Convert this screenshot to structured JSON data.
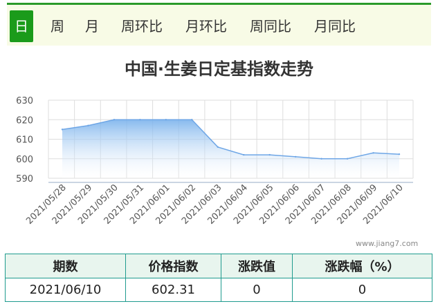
{
  "tabs": [
    "日",
    "周",
    "月",
    "周环比",
    "月环比",
    "周同比",
    "月同比"
  ],
  "chart_data": {
    "type": "area",
    "title": "中国·生姜日定基指数走势",
    "x": [
      "2021/05/28",
      "2021/05/29",
      "2021/05/30",
      "2021/05/31",
      "2021/06/01",
      "2021/06/02",
      "2021/06/03",
      "2021/06/04",
      "2021/06/05",
      "2021/06/06",
      "2021/06/07",
      "2021/06/08",
      "2021/06/09",
      "2021/06/10"
    ],
    "values": [
      615.0,
      617.0,
      620.0,
      620.0,
      620.0,
      620.0,
      606.0,
      602.0,
      602.0,
      601.0,
      600.0,
      600.0,
      603.0,
      602.31
    ],
    "yticks": [
      590,
      600,
      610,
      620,
      630
    ],
    "ylim": [
      590,
      630
    ],
    "grid": true,
    "colors": {
      "line": "#6ea6e6",
      "fill_top": "#7ab2ec",
      "fill_bottom": "#ffffff",
      "grid": "#dddddd",
      "axis": "#b9c7d8"
    }
  },
  "watermark": "www.jiang7.com",
  "table": {
    "headers": [
      "期数",
      "价格指数",
      "涨跌值",
      "涨跌幅（%）"
    ],
    "row": [
      "2021/06/10",
      "602.31",
      "0",
      "0"
    ]
  }
}
